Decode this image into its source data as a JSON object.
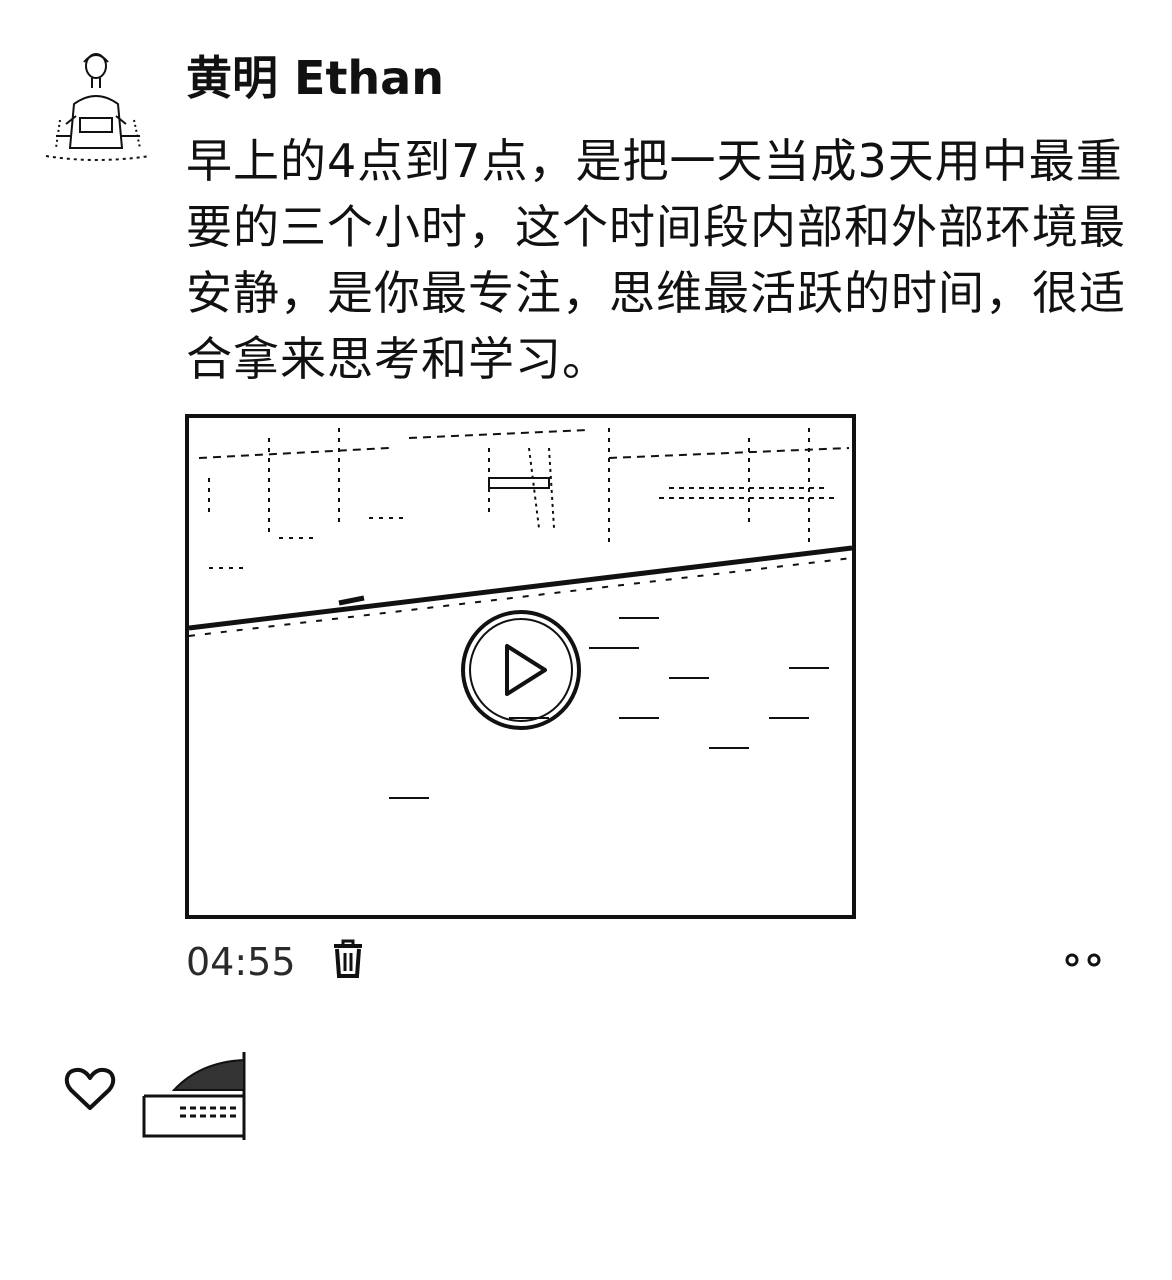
{
  "post": {
    "author_name": "黄明 Ethan",
    "text": "早上的4点到7点，是把一天当成3天用中最重要的三个小时，这个时间段内部和外部环境最安静，是你最专注，思维最活跃的时间，很适合拿来思考和学习。",
    "timestamp": "04:55"
  },
  "icons": {
    "avatar": "person-photo",
    "play": "play-circle-icon",
    "delete": "trash-icon",
    "more": "more-dots-icon",
    "like": "heart-outline-icon",
    "liker": "liker-avatar-thumbnail"
  },
  "colors": {
    "text": "#111111",
    "meta_text": "#2a2a2a",
    "background": "#ffffff"
  }
}
